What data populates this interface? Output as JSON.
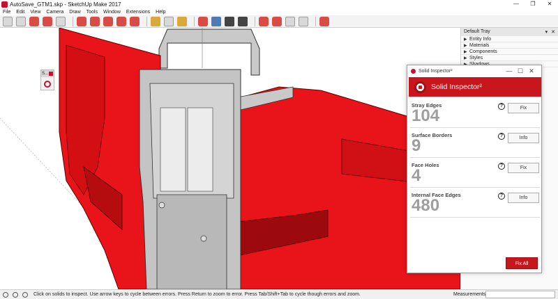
{
  "window": {
    "title": "AutoSave_GTM1.skp - SketchUp Make 2017",
    "controls": [
      "—",
      "❐",
      "✕"
    ]
  },
  "menu": [
    "File",
    "Edit",
    "View",
    "Camera",
    "Draw",
    "Tools",
    "Window",
    "Extensions",
    "Help"
  ],
  "mini_toolbar": {
    "label": "S..."
  },
  "tray": {
    "title": "Default Tray",
    "controls": [
      "▾",
      "✕"
    ],
    "items": [
      "Entity Info",
      "Materials",
      "Components",
      "Styles",
      "Shadows"
    ]
  },
  "dialog": {
    "window_title": "Solid Inspector²",
    "header_title": "Solid Inspector²",
    "controls": [
      "—",
      "☐",
      "✕"
    ],
    "errors": [
      {
        "label": "Stray Edges",
        "count": "104",
        "action": "Fix"
      },
      {
        "label": "Surface Borders",
        "count": "9",
        "action": "Info"
      },
      {
        "label": "Face Holes",
        "count": "4",
        "action": "Fix"
      },
      {
        "label": "Internal Face Edges",
        "count": "480",
        "action": "Info"
      }
    ],
    "help_symbol": "?",
    "fix_all_label": "Fix All"
  },
  "status": {
    "message": "Click on solids to inspect. Use arrow keys to cycle between errors. Press Return to zoom to error. Press Tab/Shift+Tab to cycle though errors and zoom.",
    "measurements_label": "Measurements"
  },
  "colors": {
    "model_red": "#e8141a",
    "grey": "#b8b8b8",
    "accent": "#c8161c"
  }
}
